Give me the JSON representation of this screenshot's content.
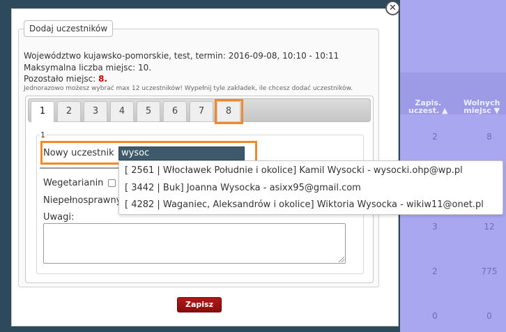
{
  "background": {
    "columns": [
      {
        "line1": "Zapis.",
        "line2": "uczest. ▲"
      },
      {
        "line1": "Wolnych",
        "line2": "miejsc ▼"
      }
    ],
    "rows": [
      [
        "2",
        "8"
      ],
      [
        "3",
        "12"
      ],
      [
        "2",
        "775"
      ],
      [
        "0",
        "0"
      ]
    ]
  },
  "modal": {
    "close_glyph": "✕",
    "legend": "Dodaj uczestników",
    "info_line1": "Województwo kujawsko-pomorskie, test, termin: 2016-09-08, 10:10 - 10:11",
    "info_line2": "Maksymalna liczba miejsc: 10.",
    "info_line3_prefix": "Pozostało miejsc: ",
    "info_line3_value": "8.",
    "note": "Jednorazowo możesz wybrać max 12 uczestników! Wypełnij tyle zakładek, ile chcesz dodać uczestników.",
    "tabs": [
      "1",
      "2",
      "3",
      "4",
      "5",
      "6",
      "7",
      "8"
    ],
    "active_tab": "1",
    "form": {
      "legend": "1",
      "new_participant_label": "Nowy uczestnik",
      "new_participant_value": "wysoc",
      "vegetarian_label": "Wegetarianin",
      "disabled_label": "Niepełnosprawny",
      "remarks_label": "Uwagi:"
    },
    "autocomplete": [
      "[ 2561 | Włocławek Południe i okolice] Kamil Wysocki - wysocki.ohp@wp.pl",
      "[ 3442 | Buk] Joanna Wysocka - asixx95@gmail.com",
      "[ 4282 | Waganiec, Aleksandrów i okolice] Wiktoria Wysocka - wikiw11@onet.pl"
    ],
    "save_label": "Zapisz"
  },
  "colors": {
    "accent_highlight": "#ef8a2c",
    "save_button": "#9a1010",
    "remaining_value": "#cc0000",
    "backdrop": "#2c4a5c"
  }
}
